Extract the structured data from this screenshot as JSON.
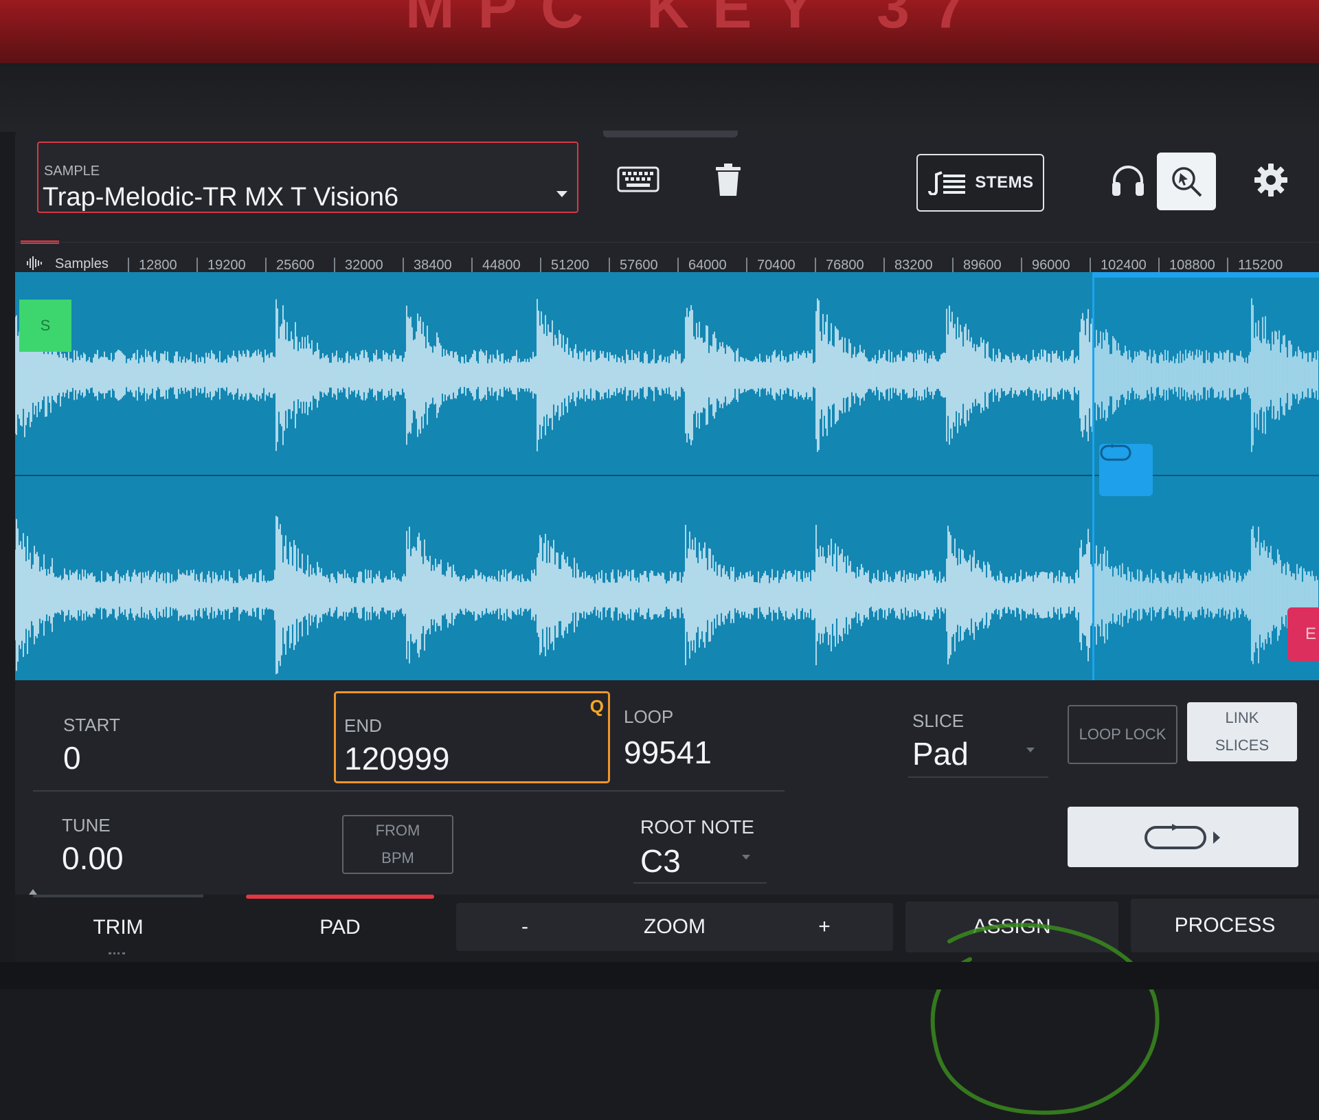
{
  "bezel": {
    "logo": "MPC KEY 37"
  },
  "header": {
    "sample_caption": "SAMPLE",
    "sample_name": "Trap-Melodic-TR MX T Vision6",
    "stems_label": "STEMS"
  },
  "icons": [
    "keyboard-icon",
    "trash-icon",
    "stems-icon",
    "headphones-icon",
    "zoom-select-icon",
    "gear-icon",
    "waveform-icon",
    "loop-icon",
    "loop-play-icon"
  ],
  "ruler": {
    "label": "Samples",
    "ticks": [
      "12800",
      "19200",
      "25600",
      "32000",
      "38400",
      "44800",
      "51200",
      "57600",
      "64000",
      "70400",
      "76800",
      "83200",
      "89600",
      "96000",
      "102400",
      "108800",
      "115200"
    ]
  },
  "waveform": {
    "start_marker": "S",
    "end_marker": "E"
  },
  "params": {
    "start_label": "START",
    "start_value": "0",
    "end_label": "END",
    "end_value": "120999",
    "end_quantize": "Q",
    "loop_label": "LOOP",
    "loop_value": "99541",
    "slice_label": "SLICE",
    "slice_value": "Pad",
    "loop_lock_label": "LOOP LOCK",
    "link_slices_line1": "LINK",
    "link_slices_line2": "SLICES",
    "tune_label": "TUNE",
    "tune_value": "0.00",
    "from_bpm_line1": "FROM",
    "from_bpm_line2": "BPM",
    "root_note_label": "ROOT NOTE",
    "root_note_value": "C3"
  },
  "tabs": {
    "trim": "TRIM",
    "pad": "PAD",
    "zoom_minus": "-",
    "zoom": "ZOOM",
    "zoom_plus": "+",
    "assign": "ASSIGN",
    "process": "PROCESS"
  },
  "colors": {
    "accent_red": "#e23843",
    "end_highlight": "#f0962a",
    "waveform_bg": "#1386b2",
    "loop_blue": "#1da3ee",
    "start_green": "#3dd66e",
    "end_pink": "#dc2f5e"
  }
}
